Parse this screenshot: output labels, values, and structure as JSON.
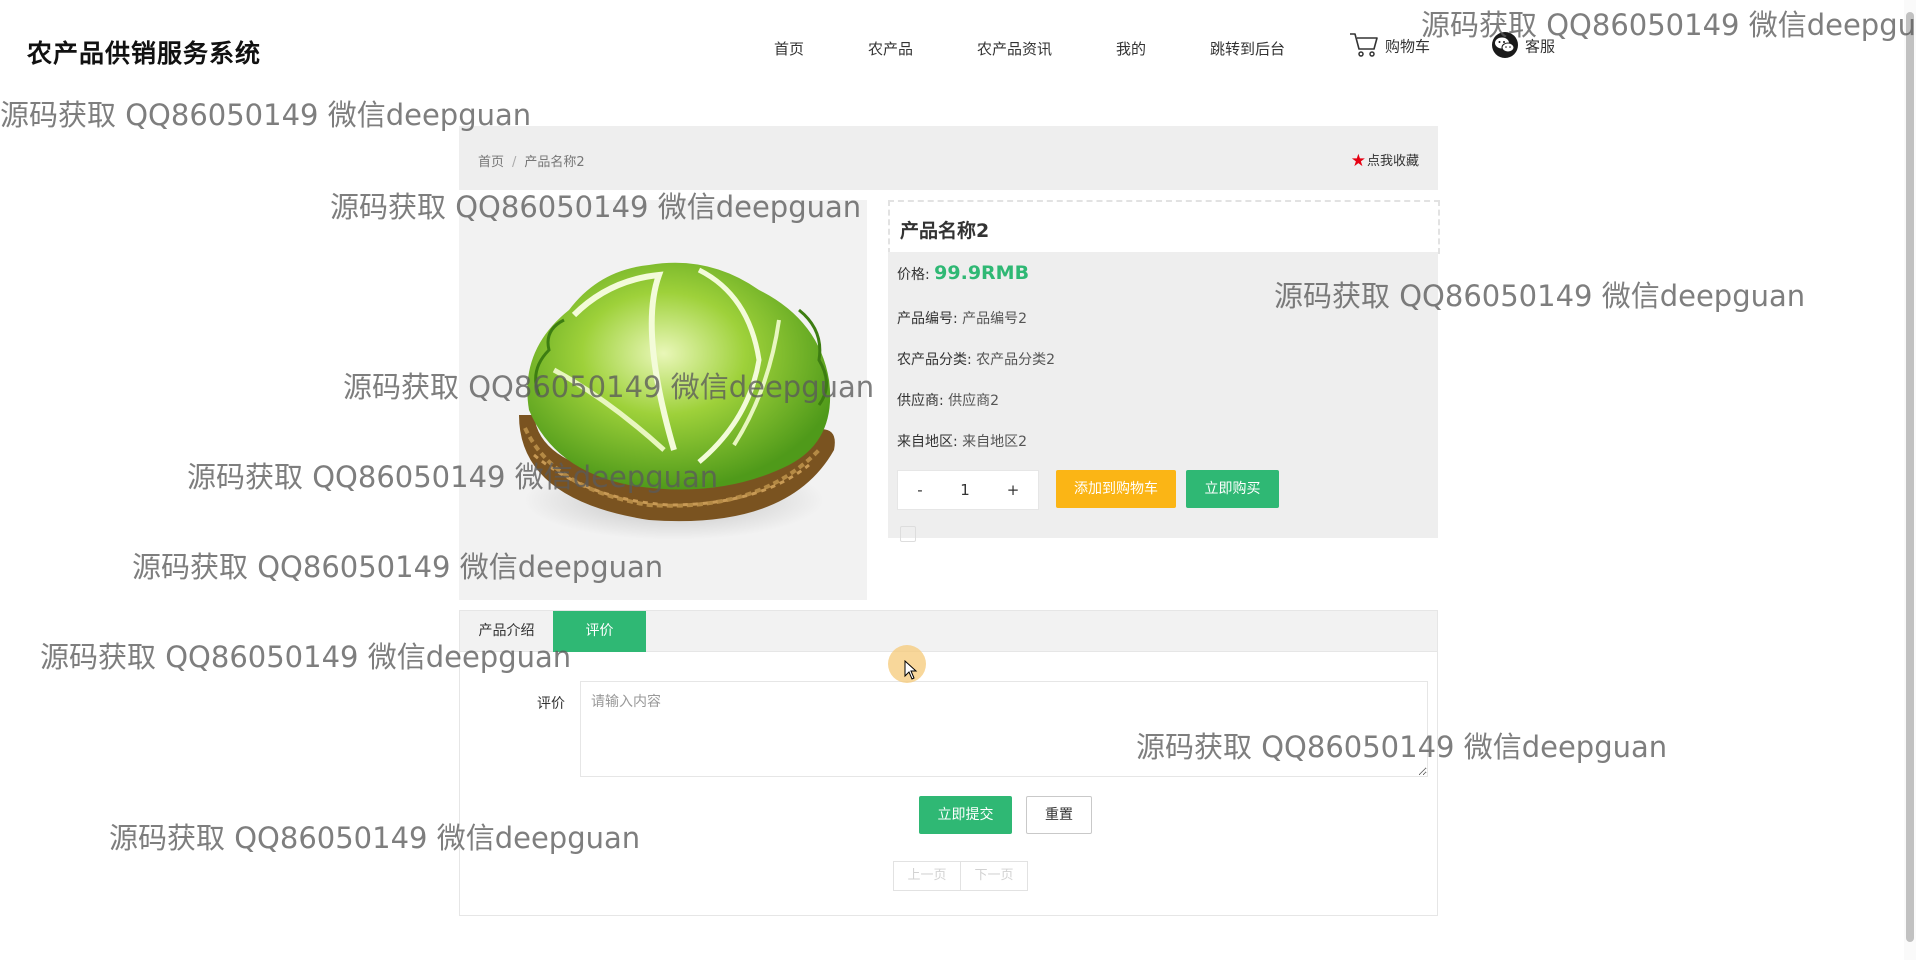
{
  "header": {
    "site_title": "农产品供销服务系统",
    "nav": [
      {
        "label": "首页"
      },
      {
        "label": "农产品"
      },
      {
        "label": "农产品资讯"
      },
      {
        "label": "我的"
      },
      {
        "label": "跳转到后台"
      },
      {
        "label": "购物车",
        "icon": "cart-icon"
      },
      {
        "label": "客服",
        "icon": "wechat-icon"
      }
    ]
  },
  "breadcrumb": {
    "home": "首页",
    "separator": "/",
    "current": "产品名称2"
  },
  "favorite": {
    "label": "点我收藏",
    "icon": "star-icon",
    "color": "#e60012"
  },
  "product": {
    "name": "产品名称2",
    "price_label": "价格:",
    "price_value": "99.9RMB",
    "fields": [
      {
        "label": "产品编号:",
        "value": "产品编号2"
      },
      {
        "label": "农产品分类:",
        "value": "农产品分类2"
      },
      {
        "label": "供应商:",
        "value": "供应商2"
      },
      {
        "label": "来自地区:",
        "value": "来自地区2"
      }
    ],
    "image": "lettuce-basket"
  },
  "quantity": {
    "decrement": "-",
    "value": "1",
    "increment": "+"
  },
  "actions": {
    "add_to_cart": "添加到购物车",
    "buy_now": "立即购买"
  },
  "tabs": [
    {
      "label": "产品介绍",
      "active": false
    },
    {
      "label": "评价",
      "active": true
    }
  ],
  "review": {
    "label": "评价",
    "placeholder": "请输入内容",
    "submit": "立即提交",
    "reset": "重置"
  },
  "pagination": {
    "prev": "上一页",
    "next": "下一页"
  },
  "watermark": "源码获取 QQ86050149 微信deepguan",
  "colors": {
    "accent_green": "#2fb874",
    "accent_orange": "#fbb515",
    "panel_gray": "#eeeeee"
  }
}
